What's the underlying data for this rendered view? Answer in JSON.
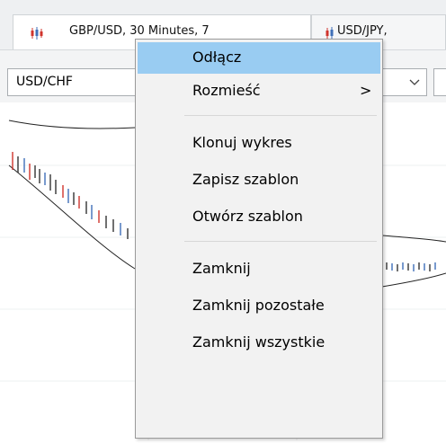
{
  "tabs": [
    {
      "label": "GBP/USD, 30 Minutes, 7",
      "icon": "candlestick-chart-icon"
    },
    {
      "label": "USD/JPY,",
      "icon": "candlestick-chart-icon"
    }
  ],
  "toolbar": {
    "symbol": "USD/CHF",
    "dropdown_icon": "chevron-down-icon"
  },
  "context_menu": {
    "items": [
      {
        "label": "Odłącz",
        "selected": true
      },
      {
        "label": "Rozmieść",
        "submenu_arrow": ">"
      },
      {
        "label": "Klonuj wykres"
      },
      {
        "label": "Zapisz szablon"
      },
      {
        "label": "Otwórz szablon"
      },
      {
        "label": "Zamknij"
      },
      {
        "label": "Zamknij pozostałe"
      },
      {
        "label": "Zamknij wszystkie"
      }
    ]
  },
  "colors": {
    "menu_highlight": "#99ccf2",
    "candle_red": "#d0342c",
    "candle_blue": "#3f6fb8"
  }
}
